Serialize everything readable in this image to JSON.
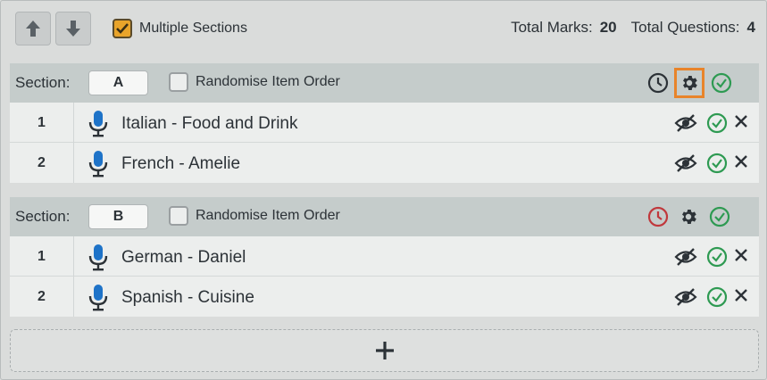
{
  "toolbar": {
    "multiple_sections": {
      "label": "Multiple Sections",
      "checked": true
    },
    "total_marks_label": "Total Marks:",
    "total_marks": "20",
    "total_questions_label": "Total Questions:",
    "total_questions": "4"
  },
  "sections": [
    {
      "label": "Section:",
      "letter": "A",
      "randomise_label": "Randomise Item Order",
      "timer_color": "#2c3237",
      "items": [
        {
          "number": "1",
          "title": "Italian - Food and Drink"
        },
        {
          "number": "2",
          "title": "French - Amelie"
        }
      ]
    },
    {
      "label": "Section:",
      "letter": "B",
      "randomise_label": "Randomise Item Order",
      "timer_color": "#c0383c",
      "items": [
        {
          "number": "1",
          "title": "German - Daniel"
        },
        {
          "number": "2",
          "title": "Spanish - Cuisine"
        }
      ]
    }
  ],
  "add_button": {
    "label": "+"
  },
  "colors": {
    "accent_orange": "#e8842a",
    "check_green": "#2e9a52",
    "mic_blue": "#1e73c8",
    "timer_red": "#c0383c"
  },
  "icons": [
    "arrow-up-icon",
    "arrow-down-icon",
    "clock-icon",
    "gear-icon",
    "check-circle-icon",
    "microphone-icon",
    "eye-slash-icon",
    "close-icon",
    "plus-icon"
  ]
}
